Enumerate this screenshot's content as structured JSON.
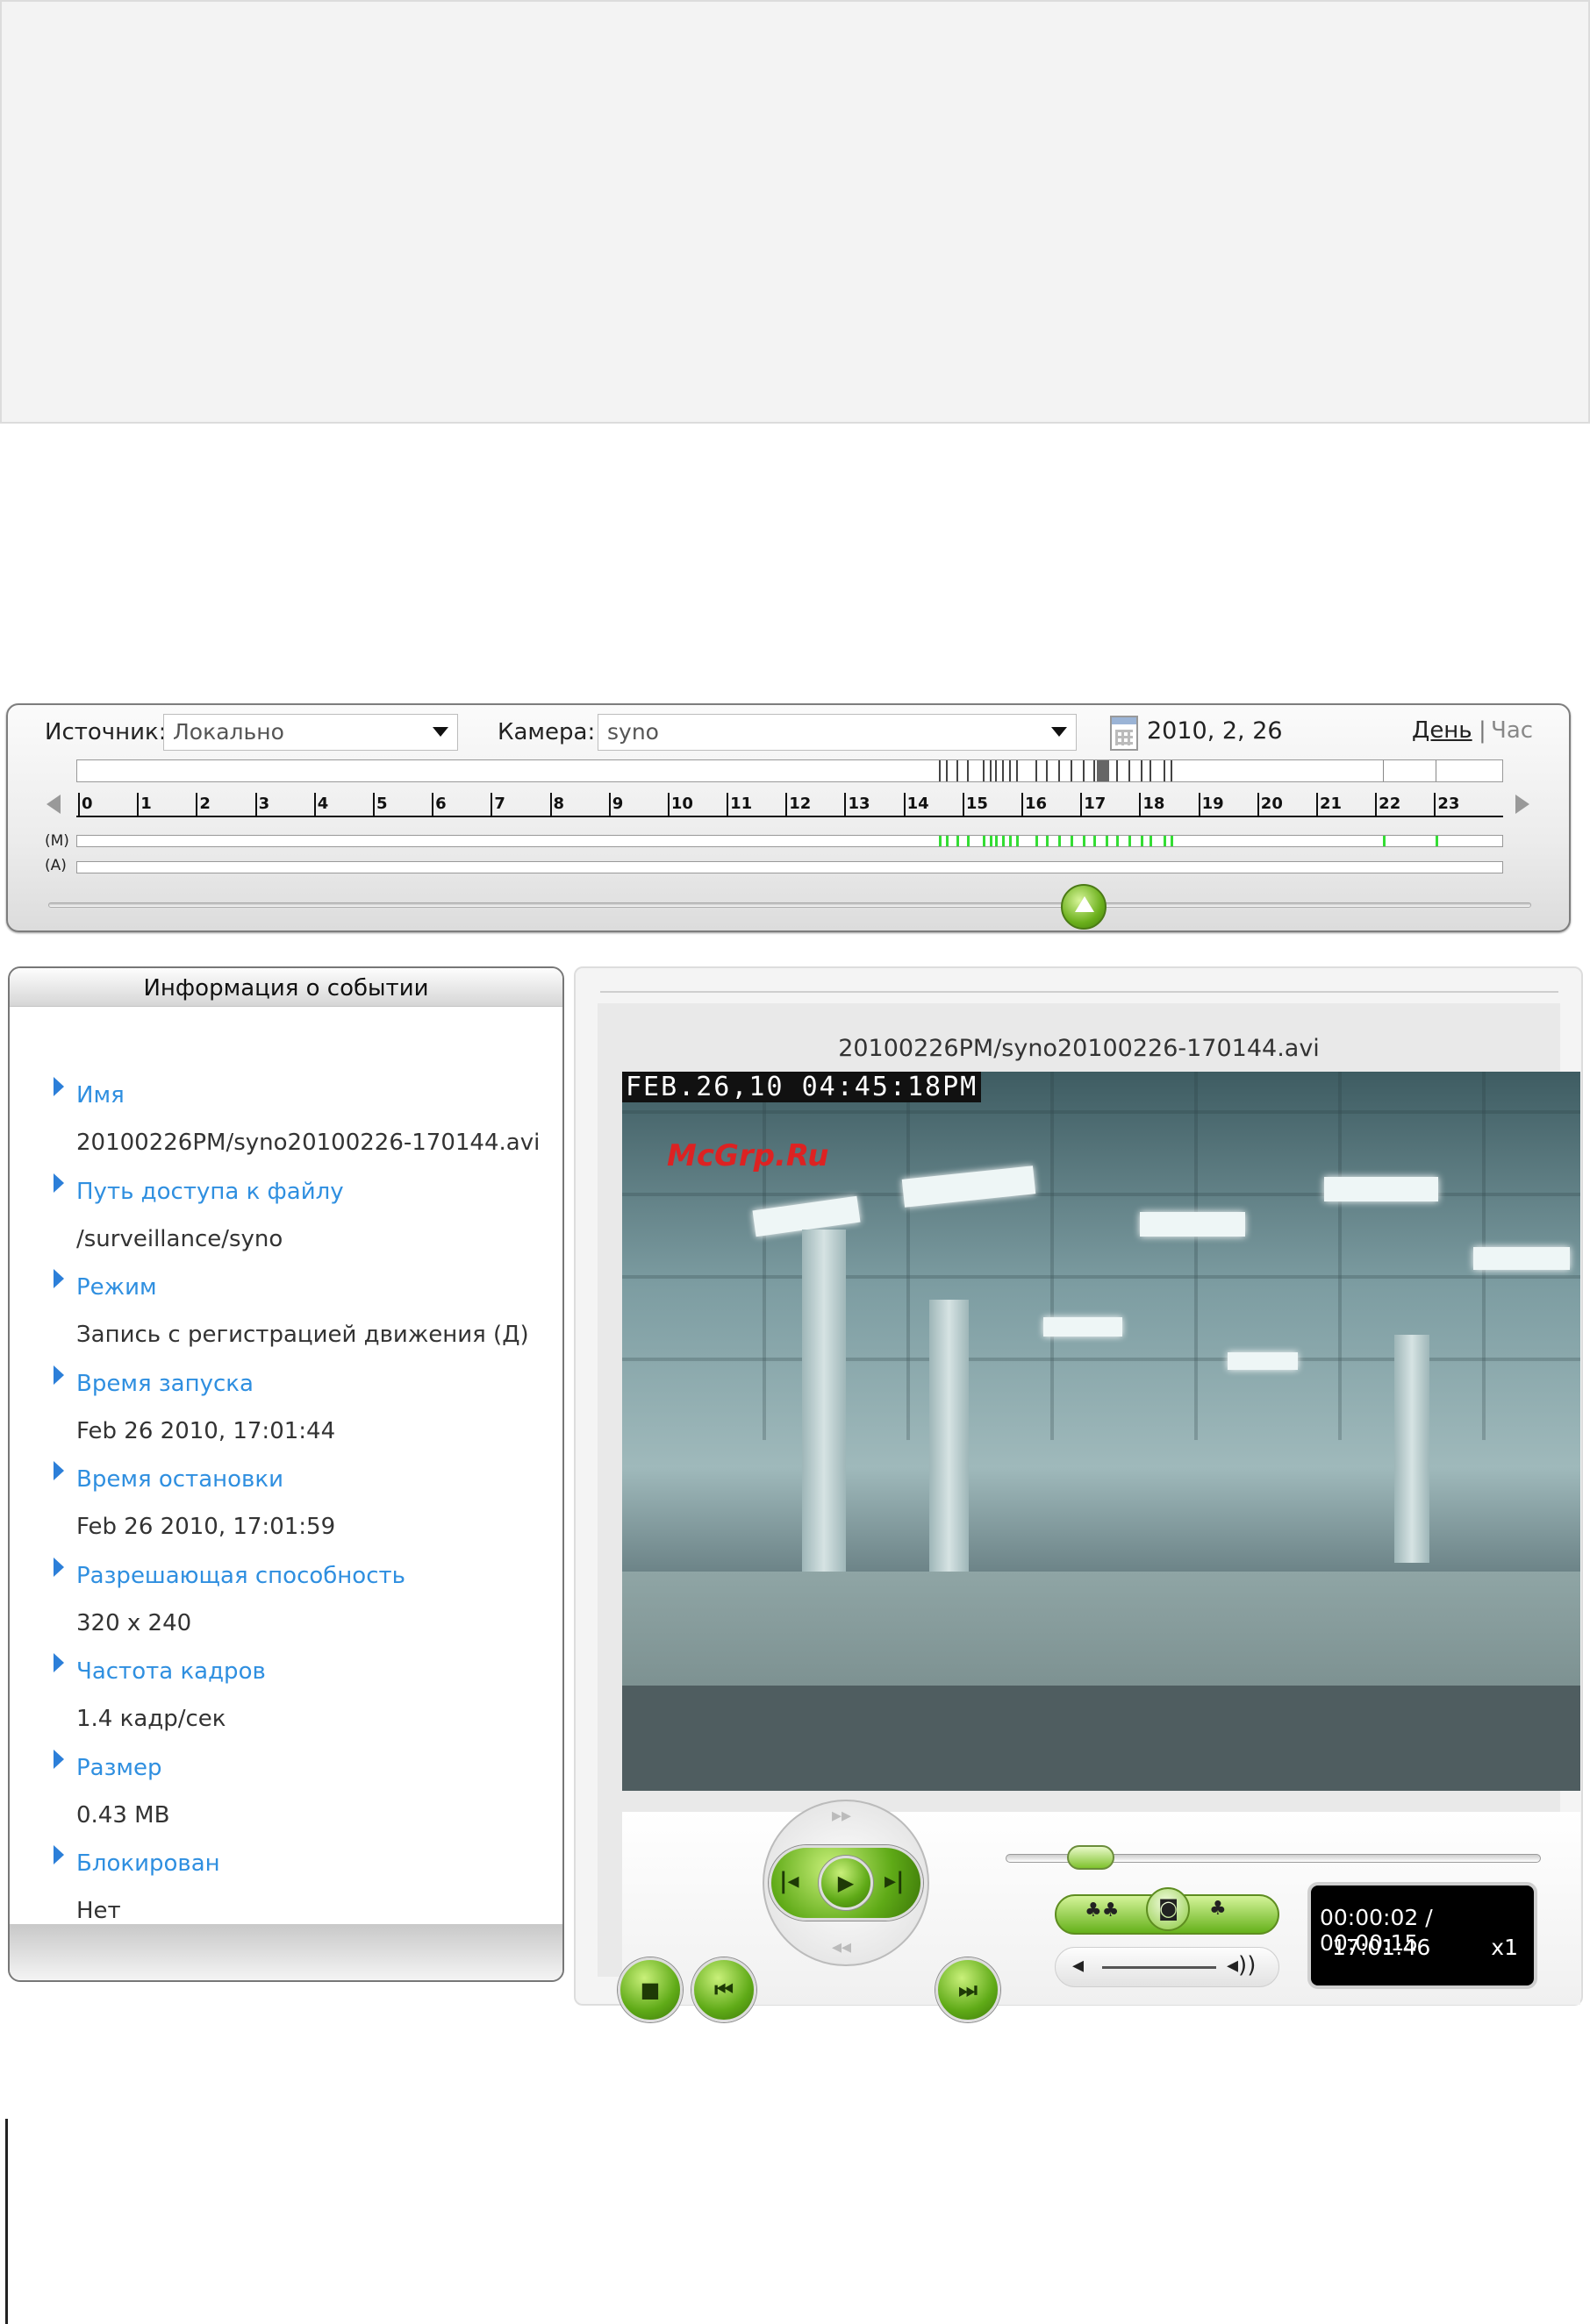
{
  "timeline": {
    "source_label": "Источник:",
    "source_value": "Локально",
    "camera_label": "Камера:",
    "camera_value": "syno",
    "date": "2010, 2, 26",
    "view_day": "День",
    "view_separator": "|",
    "view_hour": "Час",
    "hours": [
      "0",
      "1",
      "2",
      "3",
      "4",
      "5",
      "6",
      "7",
      "8",
      "9",
      "10",
      "11",
      "12",
      "13",
      "14",
      "15",
      "16",
      "17",
      "18",
      "19",
      "20",
      "21",
      "22",
      "23"
    ],
    "row_motion_label": "(M)",
    "row_alarm_label": "(A)"
  },
  "event_info": {
    "title": "Информация о событии",
    "fields": [
      {
        "key": "Имя",
        "value": "20100226PM/syno20100226-170144.avi"
      },
      {
        "key": "Путь доступа к файлу",
        "value": "/surveillance/syno"
      },
      {
        "key": "Режим",
        "value": "Запись с регистрацией движения (Д)"
      },
      {
        "key": "Время запуска",
        "value": "Feb 26 2010, 17:01:44"
      },
      {
        "key": "Время остановки",
        "value": "Feb 26 2010, 17:01:59"
      },
      {
        "key": "Разрешающая способность",
        "value": "320 x 240"
      },
      {
        "key": "Частота кадров",
        "value": "1.4 кадр/сек"
      },
      {
        "key": "Размер",
        "value": "0.43 MB"
      },
      {
        "key": "Блокирован",
        "value": "Нет"
      }
    ]
  },
  "player": {
    "file_name": "20100226PM/syno20100226-170144.avi",
    "osd_timestamp": "FEB.26,10 04:45:18PM",
    "watermark": "McGrp.Ru",
    "time_position": "00:00:02 / 00:00:15",
    "clock": "17:01:46",
    "speed": "x1"
  },
  "icons": [
    "stop-icon",
    "previous-icon",
    "step-back-icon",
    "play-icon",
    "step-forward-icon",
    "next-icon",
    "fast-forward-icon",
    "rewind-icon",
    "zoom-out-icon",
    "snapshot-icon",
    "zoom-in-icon",
    "volume-low-icon",
    "volume-high-icon",
    "calendar-icon"
  ],
  "colors": {
    "accent_green": "#6bb01c",
    "link_blue": "#2f8fe0",
    "motion_green": "#33dd33"
  }
}
